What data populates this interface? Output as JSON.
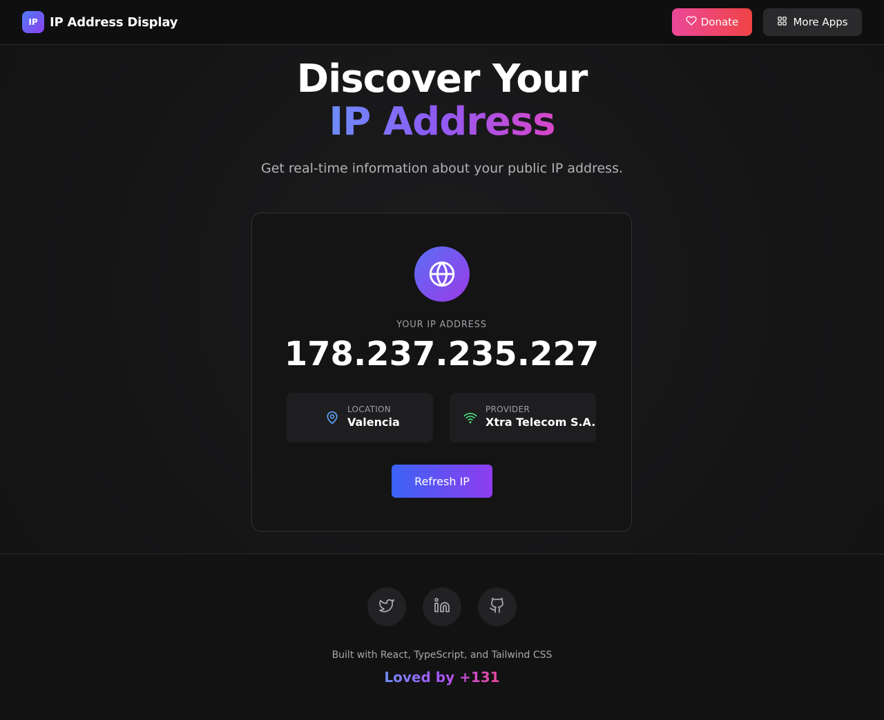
{
  "header": {
    "logo_text": "IP",
    "app_name": "IP Address Display",
    "donate_label": "Donate",
    "more_apps_label": "More Apps"
  },
  "hero": {
    "title_line1": "Discover Your",
    "title_line2": "IP Address",
    "subtitle": "Get real-time information about your public IP address."
  },
  "card": {
    "ip_label": "YOUR IP ADDRESS",
    "ip_value": "178.237.235.227",
    "location": {
      "label": "LOCATION",
      "value": "Valencia",
      "icon": "map-pin-icon"
    },
    "provider": {
      "label": "PROVIDER",
      "value": "Xtra Telecom S.A.",
      "icon": "wifi-icon"
    },
    "refresh_label": "Refresh IP"
  },
  "footer": {
    "socials": [
      {
        "name": "twitter",
        "icon": "twitter-icon"
      },
      {
        "name": "linkedin",
        "icon": "linkedin-icon"
      },
      {
        "name": "github",
        "icon": "github-icon"
      }
    ],
    "built_with": "Built with React, TypeScript, and Tailwind CSS",
    "loved_by": "Loved by +131"
  },
  "colors": {
    "accent_blue": "#3b63f5",
    "accent_purple": "#8e3df0",
    "donate_pink": "#ec4899",
    "donate_red": "#ef4444",
    "location_icon": "#60a5fa",
    "provider_icon": "#4ade80"
  }
}
